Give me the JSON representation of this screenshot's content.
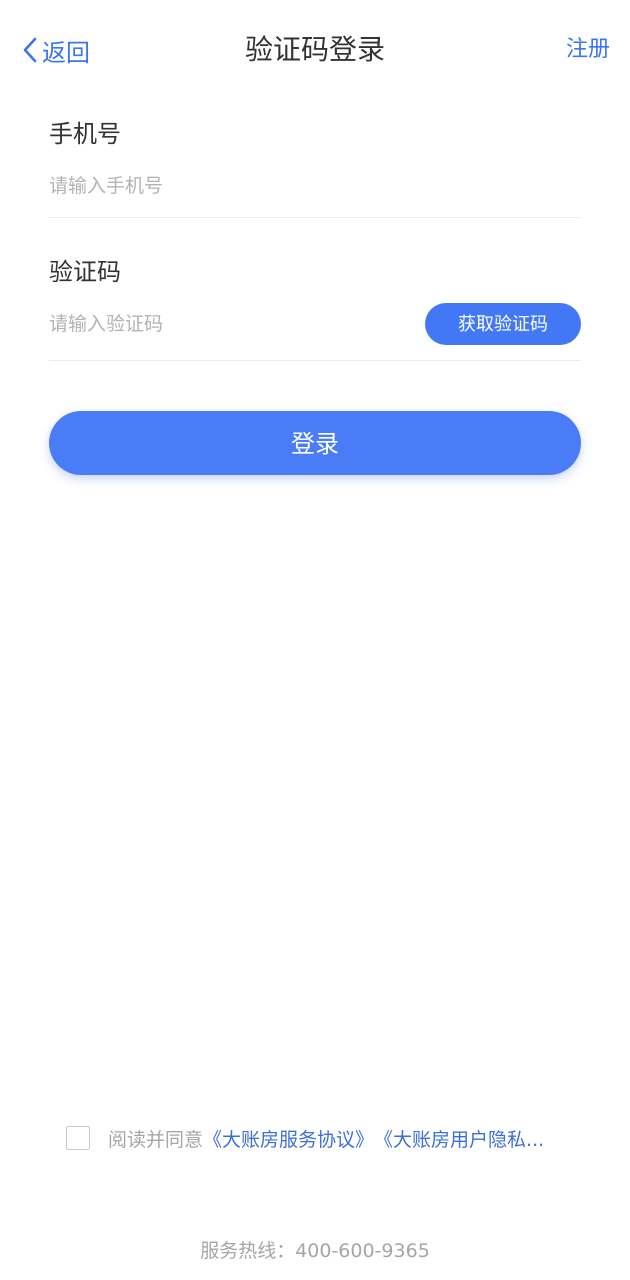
{
  "header": {
    "back_label": "返回",
    "title": "验证码登录",
    "register_label": "注册"
  },
  "form": {
    "phone": {
      "label": "手机号",
      "placeholder": "请输入手机号"
    },
    "code": {
      "label": "验证码",
      "placeholder": "请输入验证码",
      "get_code_label": "获取验证码"
    },
    "login_label": "登录"
  },
  "agreement": {
    "checked": false,
    "prefix": "阅读并同意",
    "service_link": "《大账房服务协议》",
    "privacy_link": "《大账房用户隐私..."
  },
  "hotline": {
    "text": "服务热线：400-600-9365"
  },
  "colors": {
    "accent": "#4278f6",
    "link": "#3d74f3",
    "placeholder": "#b3b3b3"
  },
  "icons": {
    "back": "chevron-left-icon",
    "checkbox": "checkbox-unchecked"
  }
}
